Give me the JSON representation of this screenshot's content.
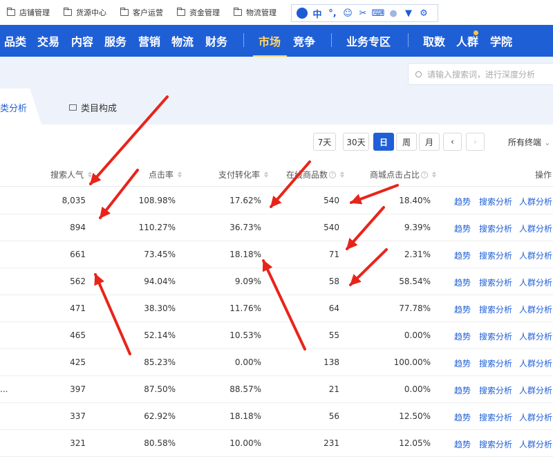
{
  "topbar": {
    "items": [
      "店铺管理",
      "货源中心",
      "客户运营",
      "资金管理",
      "物流管理"
    ],
    "ime": [
      "中",
      "°,"
    ]
  },
  "nav": {
    "items": [
      "品类",
      "交易",
      "内容",
      "服务",
      "营销",
      "物流",
      "财务",
      "市场",
      "竞争",
      "业务专区",
      "取数",
      "人群",
      "学院"
    ],
    "active": "市场"
  },
  "search": {
    "placeholder": "请输入搜索词，进行深度分析"
  },
  "tabs": {
    "first": "类分析",
    "second": "类目构成"
  },
  "controls": {
    "day7": "7天",
    "day30": "30天",
    "day": "日",
    "week": "周",
    "month": "月",
    "prev": "‹",
    "next": "›",
    "device": "所有终端"
  },
  "table": {
    "headers": [
      "搜索人气",
      "点击率",
      "支付转化率",
      "在线商品数",
      "商城点击占比",
      "操作"
    ],
    "actions": [
      "趋势",
      "搜索分析",
      "人群分析"
    ],
    "rows": [
      {
        "name": "",
        "pop": "8,035",
        "ctr": "108.98%",
        "cvr": "17.62%",
        "online": "540",
        "mall": "18.40%"
      },
      {
        "name": "",
        "pop": "894",
        "ctr": "110.27%",
        "cvr": "36.73%",
        "online": "540",
        "mall": "9.39%"
      },
      {
        "name": "",
        "pop": "661",
        "ctr": "73.45%",
        "cvr": "18.18%",
        "online": "71",
        "mall": "2.31%"
      },
      {
        "name": "",
        "pop": "562",
        "ctr": "94.04%",
        "cvr": "9.09%",
        "online": "58",
        "mall": "58.54%"
      },
      {
        "name": "",
        "pop": "471",
        "ctr": "38.30%",
        "cvr": "11.76%",
        "online": "64",
        "mall": "77.78%"
      },
      {
        "name": "",
        "pop": "465",
        "ctr": "52.14%",
        "cvr": "10.53%",
        "online": "55",
        "mall": "0.00%"
      },
      {
        "name": "",
        "pop": "425",
        "ctr": "85.23%",
        "cvr": "0.00%",
        "online": "138",
        "mall": "100.00%"
      },
      {
        "name": "...",
        "pop": "397",
        "ctr": "87.50%",
        "cvr": "88.57%",
        "online": "21",
        "mall": "0.00%"
      },
      {
        "name": "",
        "pop": "337",
        "ctr": "62.92%",
        "cvr": "18.18%",
        "online": "56",
        "mall": "12.50%"
      },
      {
        "name": "",
        "pop": "321",
        "ctr": "80.58%",
        "cvr": "10.00%",
        "online": "231",
        "mall": "12.05%"
      }
    ]
  },
  "colors": {
    "brand": "#1f5fd6",
    "active_nav": "#ffd666",
    "arrow": "#e8241a"
  }
}
